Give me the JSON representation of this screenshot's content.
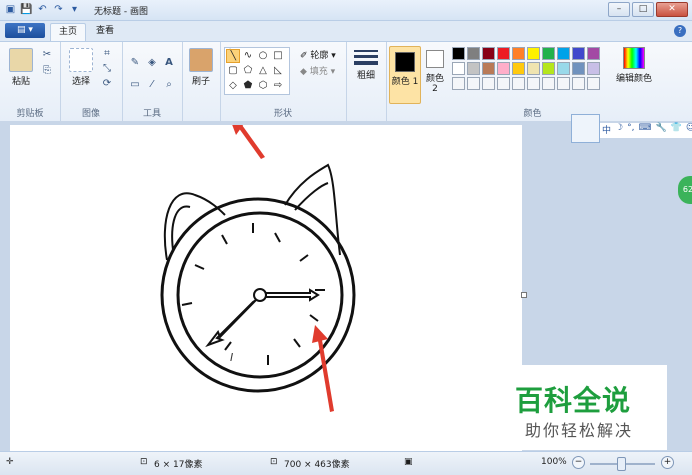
{
  "window": {
    "title": "无标题 - 画图",
    "min": "–",
    "max": "□",
    "close": "✕"
  },
  "tabs": {
    "file": "▤ ▾",
    "home": "主页",
    "view": "查看",
    "help": "?"
  },
  "ribbon": {
    "clipboard": {
      "label": "剪贴板",
      "paste": "粘贴"
    },
    "image": {
      "label": "图像",
      "select": "选择"
    },
    "tools": {
      "label": "工具"
    },
    "brushes": {
      "label": "刷子"
    },
    "shapes": {
      "label": "形状",
      "outline": "轮廓 ▾",
      "fill": "填充 ▾"
    },
    "size": {
      "label": "粗细"
    },
    "color1": {
      "label": "颜色 1"
    },
    "color2": {
      "label": "颜色 2"
    },
    "colors": {
      "label": "颜色",
      "edit": "编辑颜色"
    },
    "palette_row1": [
      "#000000",
      "#7f7f7f",
      "#880015",
      "#ed1c24",
      "#ff7f27",
      "#fff200",
      "#22b14c",
      "#00a2e8",
      "#3f48cc",
      "#a349a4"
    ],
    "palette_row2": [
      "#ffffff",
      "#c3c3c3",
      "#b97a57",
      "#ffaec9",
      "#ffc90e",
      "#efe4b0",
      "#b5e61d",
      "#99d9ea",
      "#7092be",
      "#c8bfe7"
    ]
  },
  "floating_toolbar": {
    "items": [
      "中",
      "☽",
      "°,",
      "⌨",
      "🔧",
      "👕",
      "☺"
    ]
  },
  "side_badge": "62",
  "watermark": {
    "line1": "百科全说",
    "line2": "助你轻松解决"
  },
  "status": {
    "cursor": "6 × 17像素",
    "canvas_size": "700 × 463像素",
    "zoom": "100%"
  }
}
